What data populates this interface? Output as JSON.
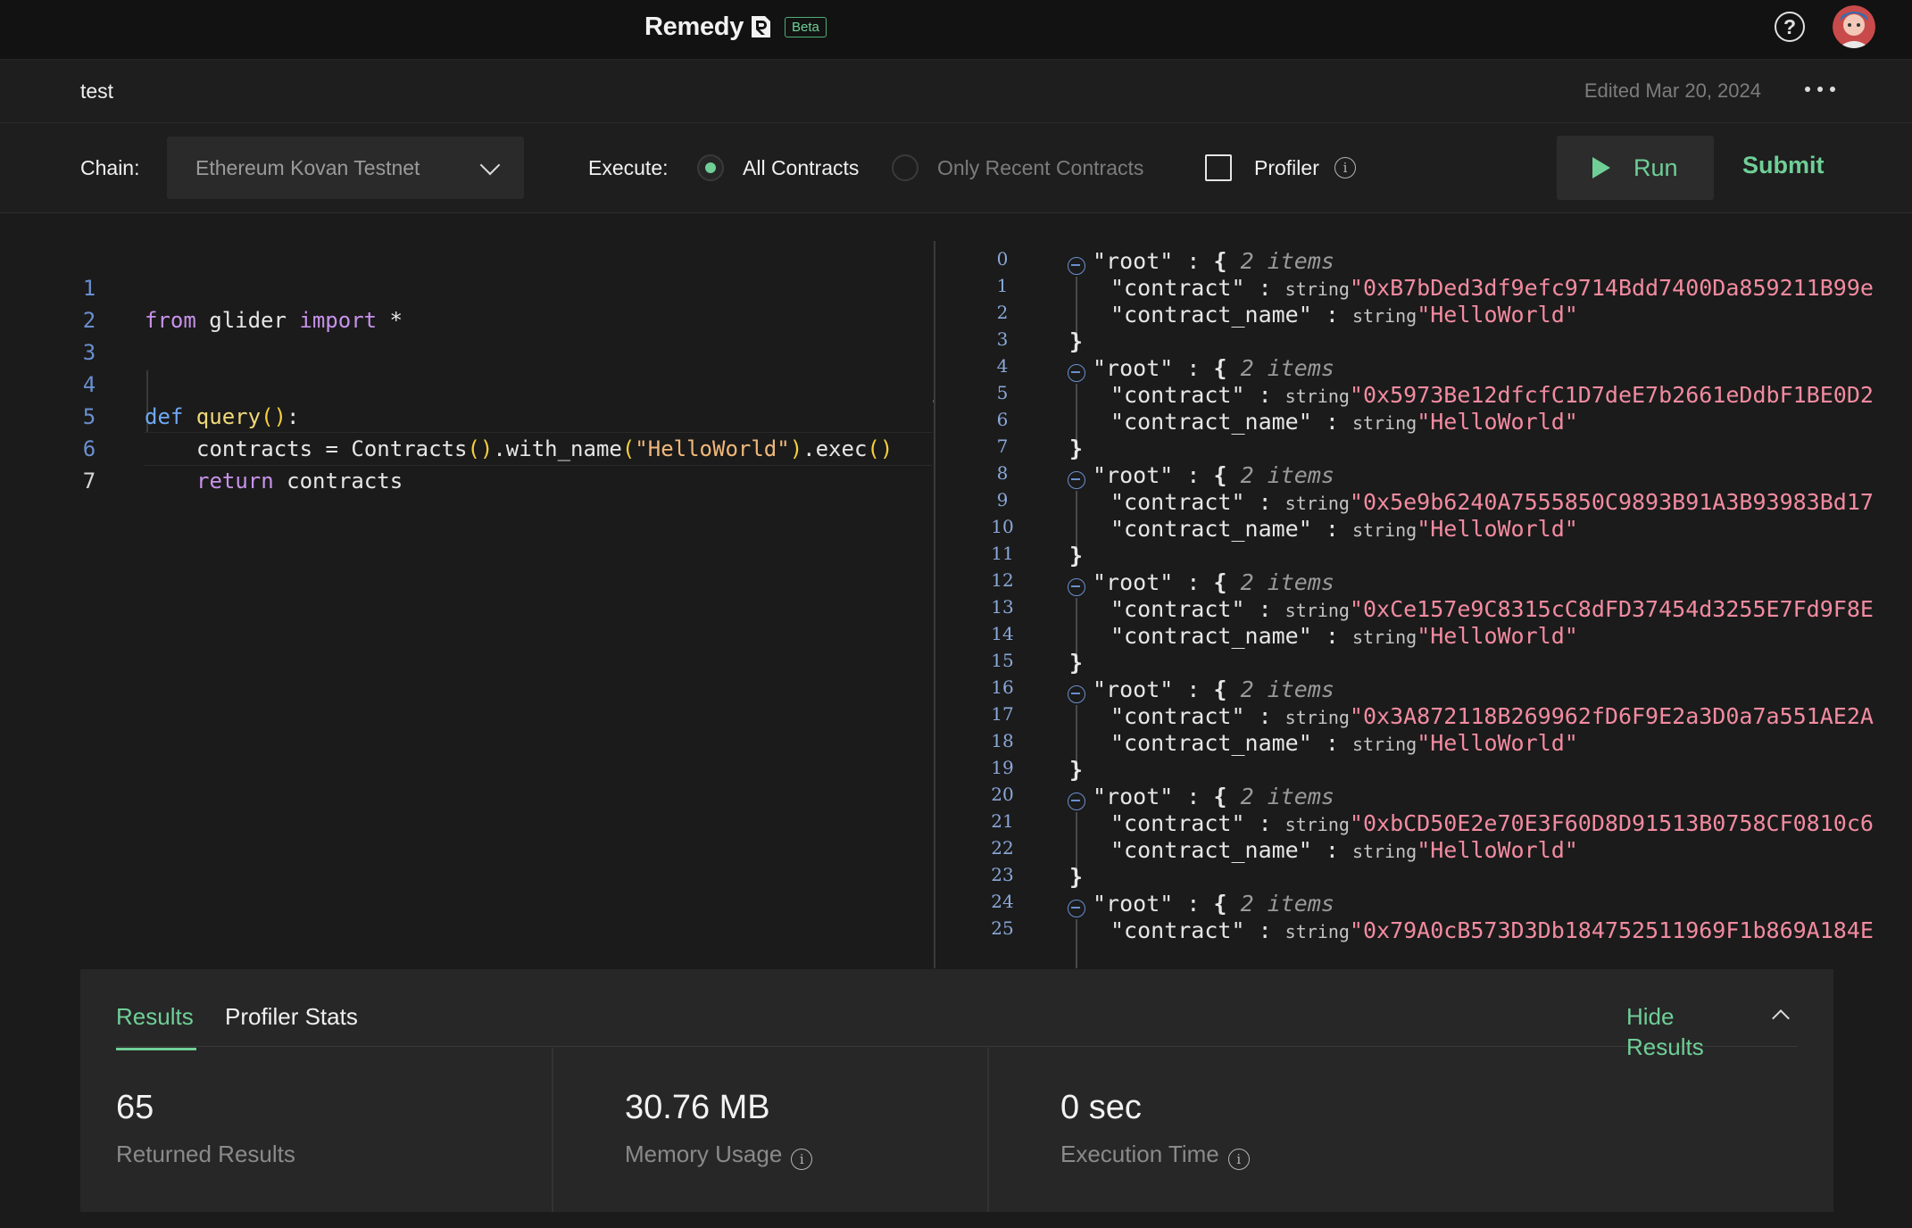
{
  "header": {
    "brand": "Remedy",
    "badge": "Beta"
  },
  "query": {
    "name": "test",
    "edited": "Edited Mar 20, 2024"
  },
  "toolbar": {
    "chain_label": "Chain:",
    "chain_value": "Ethereum Kovan Testnet",
    "execute_label": "Execute:",
    "option_all": "All Contracts",
    "option_recent": "Only Recent Contracts",
    "profiler_label": "Profiler",
    "run_label": "Run",
    "submit_label": "Submit"
  },
  "editor": {
    "line_numbers": [
      "1",
      "2",
      "3",
      "4",
      "5",
      "6",
      "7"
    ],
    "code": {
      "l1_kw1": "from",
      "l1_mod": " glider ",
      "l1_kw2": "import",
      "l1_rest": " *",
      "l4_kw": "def",
      "l4_fn": " query",
      "l4_p1": "(",
      "l4_p2": ")",
      "l4_colon": ":",
      "l5_a": "contracts = Contracts",
      "l5_p1": "()",
      "l5_b": ".with_name",
      "l5_p2": "(",
      "l5_str": "\"HelloWorld\"",
      "l5_p3": ")",
      "l5_c": ".exec",
      "l5_p4": "()",
      "l6_kw": "return",
      "l6_rest": " contracts"
    }
  },
  "json_view": {
    "line_numbers": [
      "0",
      "1",
      "2",
      "3",
      "4",
      "5",
      "6",
      "7",
      "8",
      "9",
      "10",
      "11",
      "12",
      "13",
      "14",
      "15",
      "16",
      "17",
      "18",
      "19",
      "20",
      "21",
      "22",
      "23",
      "24",
      "25"
    ],
    "root_key": "\"root\"",
    "sep": " : ",
    "open_brace": "{",
    "close_brace": "}",
    "items": "2 items",
    "key_contract": "\"contract\"",
    "key_contract_name": "\"contract_name\"",
    "type_string": "string",
    "records": [
      {
        "contract": "\"0xB7bDed3df9efc9714Bdd7400Da859211B99e",
        "name": "\"HelloWorld\""
      },
      {
        "contract": "\"0x5973Be12dfcfC1D7deE7b2661eDdbF1BE0D2",
        "name": "\"HelloWorld\""
      },
      {
        "contract": "\"0x5e9b6240A7555850C9893B91A3B93983Bd17",
        "name": "\"HelloWorld\""
      },
      {
        "contract": "\"0xCe157e9C8315cC8dFD37454d3255E7Fd9F8E",
        "name": "\"HelloWorld\""
      },
      {
        "contract": "\"0x3A872118B269962fD6F9E2a3D0a7a551AE2A",
        "name": "\"HelloWorld\""
      },
      {
        "contract": "\"0xbCD50E2e70E3F60D8D91513B0758CF0810c6",
        "name": "\"HelloWorld\""
      },
      {
        "contract": "\"0x79A0cB573D3Db184752511969F1b869A184E",
        "name": ""
      }
    ]
  },
  "results": {
    "tab_results": "Results",
    "tab_profiler": "Profiler Stats",
    "hide_label": "Hide Results",
    "stats": [
      {
        "value": "65",
        "label": "Returned Results"
      },
      {
        "value": "30.76 MB",
        "label": "Memory Usage"
      },
      {
        "value": "0 sec",
        "label": "Execution Time"
      }
    ]
  },
  "colors": {
    "accent": "#6fcf97",
    "background": "#1b1b1b",
    "string_value": "#f28ba0"
  },
  "icons": [
    "remedy-logo-icon",
    "help-icon",
    "more-icon",
    "chevron-down-icon",
    "info-icon",
    "play-icon",
    "collapse-icon",
    "chevron-up-icon"
  ]
}
